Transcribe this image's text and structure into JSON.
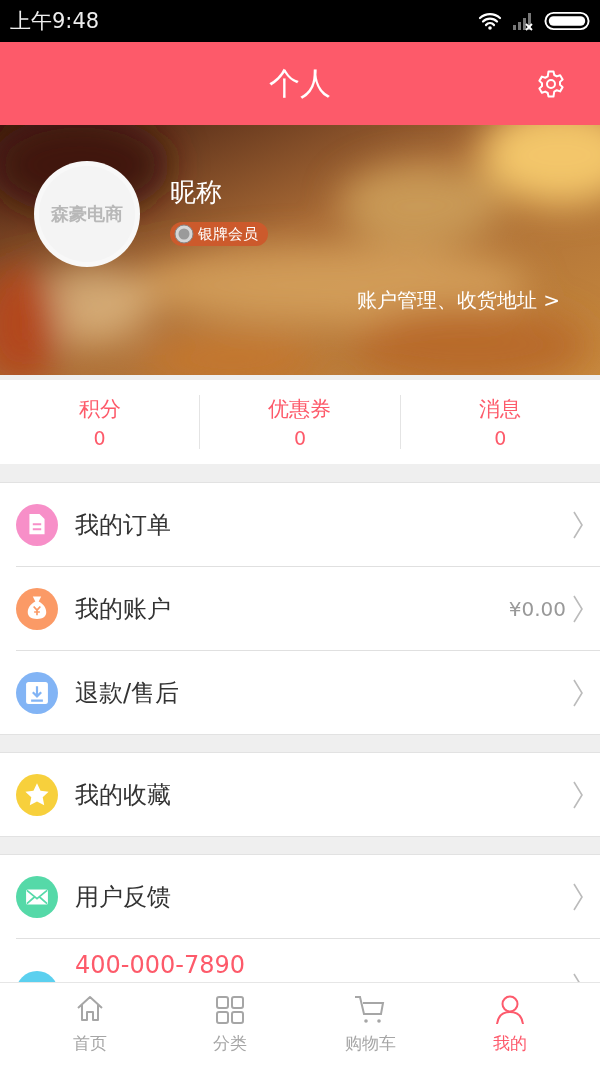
{
  "status_bar": {
    "time": "上午9:48"
  },
  "header": {
    "title": "个人"
  },
  "profile": {
    "avatar_logo": "森豪电商",
    "nickname": "昵称",
    "badge": "银牌会员",
    "account_link": "账户管理、收货地址 >"
  },
  "stats": [
    {
      "label": "积分",
      "value": "0"
    },
    {
      "label": "优惠券",
      "value": "0"
    },
    {
      "label": "消息",
      "value": "0"
    }
  ],
  "menu_groups": [
    [
      {
        "kind": "document",
        "label": "我的订单",
        "color": "#f78fc8"
      },
      {
        "kind": "moneybag",
        "label": "我的账户",
        "value": "¥0.00",
        "color": "#fb9a66"
      },
      {
        "kind": "download",
        "label": "退款/售后",
        "color": "#82b4f5"
      }
    ],
    [
      {
        "kind": "star",
        "label": "我的收藏",
        "color": "#f7d03c"
      }
    ],
    [
      {
        "kind": "mail",
        "label": "用户反馈",
        "color": "#55d9a8"
      },
      {
        "kind": "phone",
        "label": "400-000-7890",
        "cut_off": true,
        "color": "#5bd0ef"
      }
    ]
  ],
  "tab_bar": [
    {
      "kind": "home",
      "label": "首页",
      "selected": false
    },
    {
      "kind": "grid",
      "label": "分类",
      "selected": false
    },
    {
      "kind": "cart",
      "label": "购物车",
      "selected": false
    },
    {
      "kind": "person",
      "label": "我的",
      "selected": true
    }
  ]
}
